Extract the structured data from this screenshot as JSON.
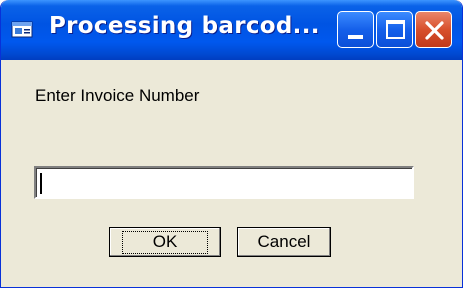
{
  "window": {
    "title": "Processing barcod...",
    "icon": "app-window-icon",
    "controls": {
      "minimize_icon": "minimize-icon",
      "maximize_icon": "maximize-icon",
      "close_icon": "close-icon"
    }
  },
  "dialog": {
    "prompt_label": "Enter Invoice Number",
    "invoice_input": {
      "value": "",
      "placeholder": ""
    },
    "ok_label": "OK",
    "cancel_label": "Cancel"
  },
  "colors": {
    "titlebar_blue": "#0054e3",
    "close_red": "#d8502c",
    "dialog_face": "#ece9d8"
  }
}
